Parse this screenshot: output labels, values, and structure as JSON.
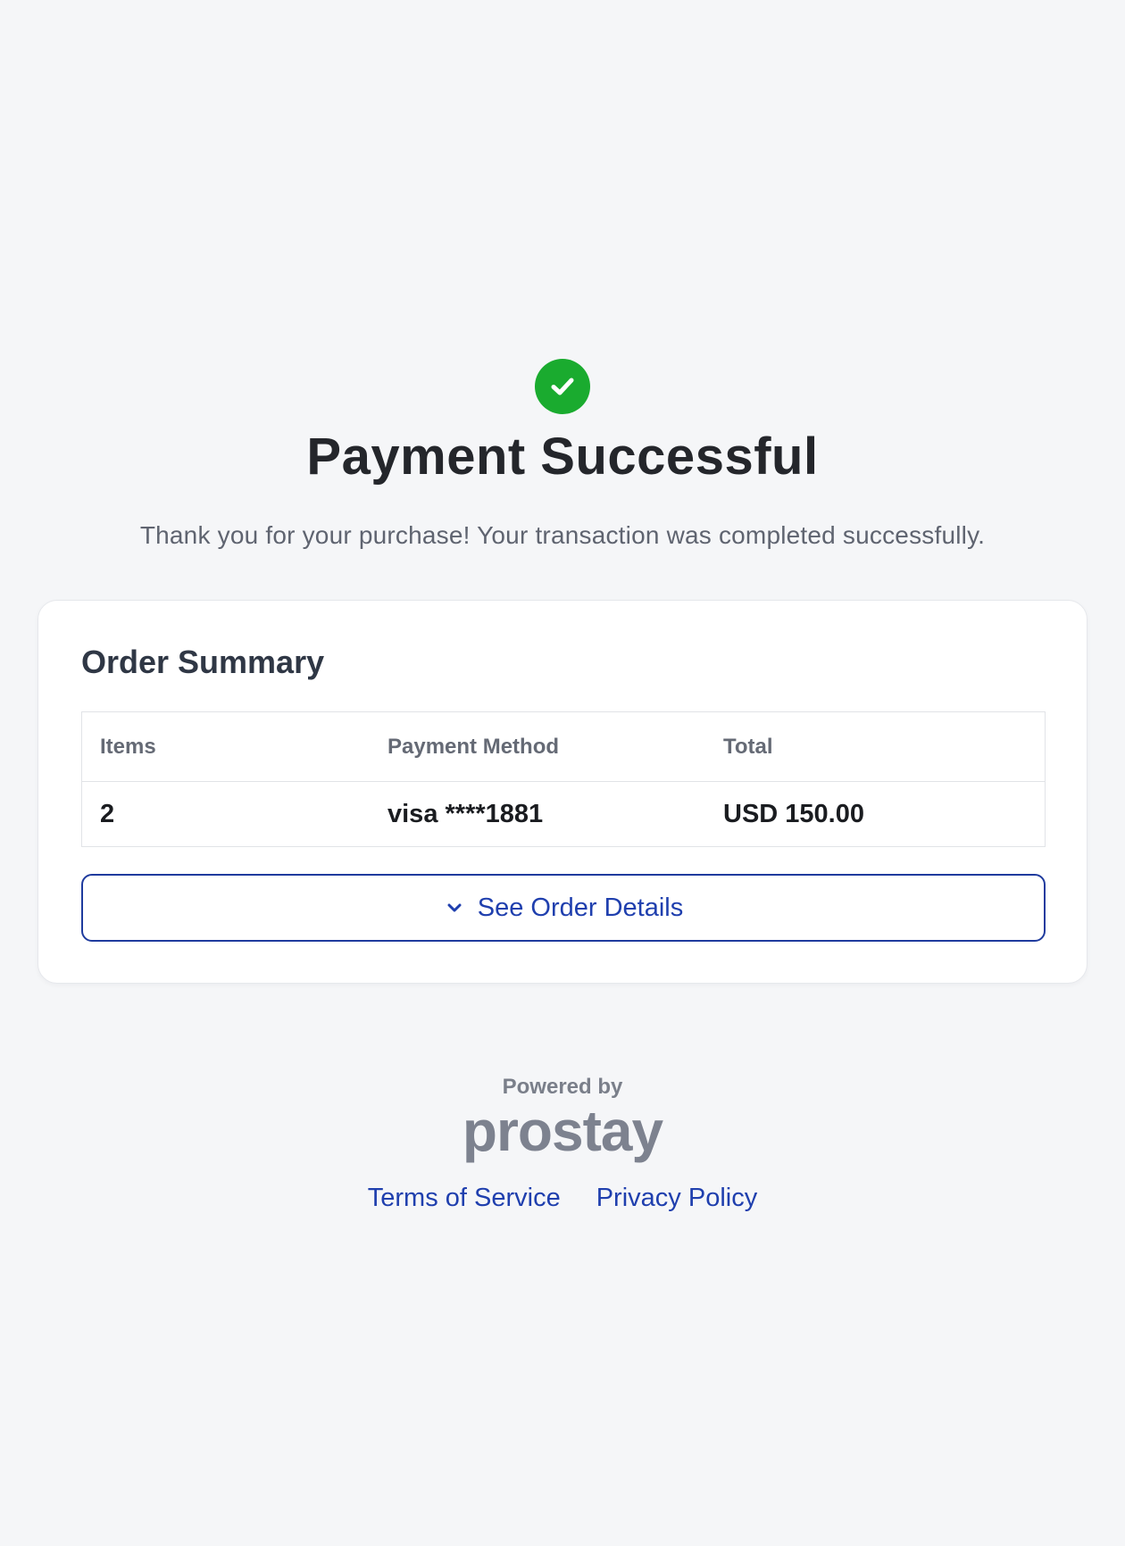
{
  "status": {
    "icon": "check-circle-icon",
    "title": "Payment Successful",
    "message": "Thank you for your purchase! Your transaction was completed successfully."
  },
  "order_summary": {
    "title": "Order Summary",
    "columns": [
      "Items",
      "Payment Method",
      "Total"
    ],
    "row": {
      "items": "2",
      "payment_method": "visa ****1881",
      "total": "USD 150.00"
    },
    "details_button": {
      "icon": "chevron-down-icon",
      "label": "See Order Details"
    }
  },
  "footer": {
    "powered_by": "Powered by",
    "brand": "prostay",
    "links": [
      "Terms of Service",
      "Privacy Policy"
    ]
  },
  "colors": {
    "success": "#1aab2f",
    "accent": "#1f3fae",
    "background": "#f5f6f8"
  }
}
